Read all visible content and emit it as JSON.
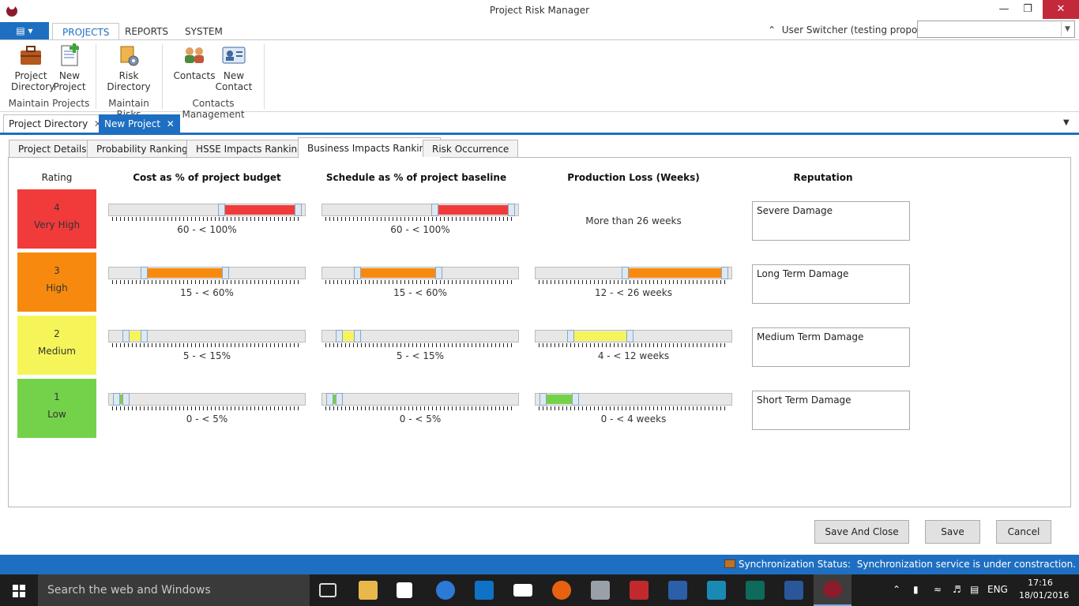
{
  "window": {
    "title": "Project Risk Manager"
  },
  "ribbon": {
    "tabs": [
      "PROJECTS",
      "REPORTS",
      "SYSTEM"
    ],
    "user_switcher_label": "User Switcher (testing propose)",
    "groups": [
      {
        "label": "Maintain Projects",
        "buttons": [
          {
            "label1": "Project",
            "label2": "Directory"
          },
          {
            "label1": "New",
            "label2": "Project"
          }
        ]
      },
      {
        "label": "Maintain Risks",
        "buttons": [
          {
            "label1": "Risk",
            "label2": "Directory"
          }
        ]
      },
      {
        "label": "Contacts Management",
        "buttons": [
          {
            "label1": "Contacts",
            "label2": ""
          },
          {
            "label1": "New",
            "label2": "Contact"
          }
        ]
      }
    ]
  },
  "doc_tabs": [
    {
      "label": "Project Directory"
    },
    {
      "label": "New Project"
    }
  ],
  "inner_tabs": [
    "Project Details",
    "Probability Ranking",
    "HSSE Impacts Ranking",
    "Business Impacts Ranking",
    "Risk Occurrence"
  ],
  "headers": {
    "rating": "Rating",
    "cost": "Cost as % of project budget",
    "schedule": "Schedule as % of project baseline",
    "production": "Production Loss (Weeks)",
    "reputation": "Reputation"
  },
  "rows": [
    {
      "num": "4",
      "label": "Very High",
      "color": "#f13b3b",
      "cost": "60 - < 100%",
      "cost_range": [
        0.58,
        1.0
      ],
      "schedule": "60 - < 100%",
      "schedule_range": [
        0.58,
        1.0
      ],
      "production": "More than 26 weeks",
      "production_range": null,
      "reputation": "Severe Damage"
    },
    {
      "num": "3",
      "label": "High",
      "color": "#f78a0e",
      "cost": "15 - < 60%",
      "cost_range": [
        0.15,
        0.6
      ],
      "schedule": "15 - < 60%",
      "schedule_range": [
        0.15,
        0.6
      ],
      "production": "12 - < 26 weeks",
      "production_range": [
        0.45,
        1.0
      ],
      "reputation": "Long Term Damage"
    },
    {
      "num": "2",
      "label": "Medium",
      "color": "#f5f55a",
      "cost": "5 - < 15%",
      "cost_range": [
        0.05,
        0.15
      ],
      "schedule": "5 - < 15%",
      "schedule_range": [
        0.05,
        0.15
      ],
      "production": "4 - < 12 weeks",
      "production_range": [
        0.15,
        0.48
      ],
      "reputation": "Medium Term Damage"
    },
    {
      "num": "1",
      "label": "Low",
      "color": "#74d24a",
      "cost": "0 - < 5%",
      "cost_range": [
        0.0,
        0.05
      ],
      "schedule": "0 - < 5%",
      "schedule_range": [
        0.0,
        0.05
      ],
      "production": "0 - < 4 weeks",
      "production_range": [
        0.0,
        0.18
      ],
      "reputation": "Short Term Damage"
    }
  ],
  "buttons": {
    "save_close": "Save And Close",
    "save": "Save",
    "cancel": "Cancel"
  },
  "status": {
    "label": "Synchronization Status:",
    "message": "Synchronization service is under constraction."
  },
  "taskbar": {
    "search_placeholder": "Search the web and Windows",
    "lang": "ENG",
    "time": "17:16",
    "date": "18/01/2016"
  }
}
